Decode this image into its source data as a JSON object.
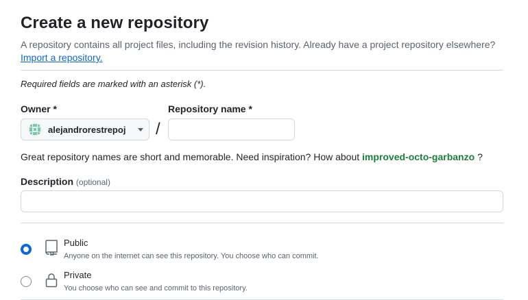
{
  "header": {
    "title": "Create a new repository",
    "subtitle": "A repository contains all project files, including the revision history. Already have a project repository elsewhere?",
    "import_link": "Import a repository."
  },
  "form": {
    "required_note": "Required fields are marked with an asterisk (*).",
    "owner_label": "Owner *",
    "owner_value": "alejandrorestrepoj",
    "slash": "/",
    "repo_name_label": "Repository name *",
    "repo_name_value": "",
    "hint_prefix": "Great repository names are short and memorable. Need inspiration? How about",
    "hint_suggestion": "improved-octo-garbanzo",
    "hint_suffix": "?",
    "description_label": "Description",
    "description_optional": "(optional)",
    "description_value": ""
  },
  "visibility": {
    "selected": "Public",
    "options": [
      {
        "label": "Public",
        "description": "Anyone on the internet can see this repository. You choose who can commit.",
        "icon": "repo-icon"
      },
      {
        "label": "Private",
        "description": "You choose who can see and commit to this repository.",
        "icon": "lock-icon"
      }
    ]
  },
  "colors": {
    "link": "#0969da",
    "suggestion": "#1a7f37",
    "radio_checked": "#0969da",
    "border": "#d1d9e0"
  }
}
